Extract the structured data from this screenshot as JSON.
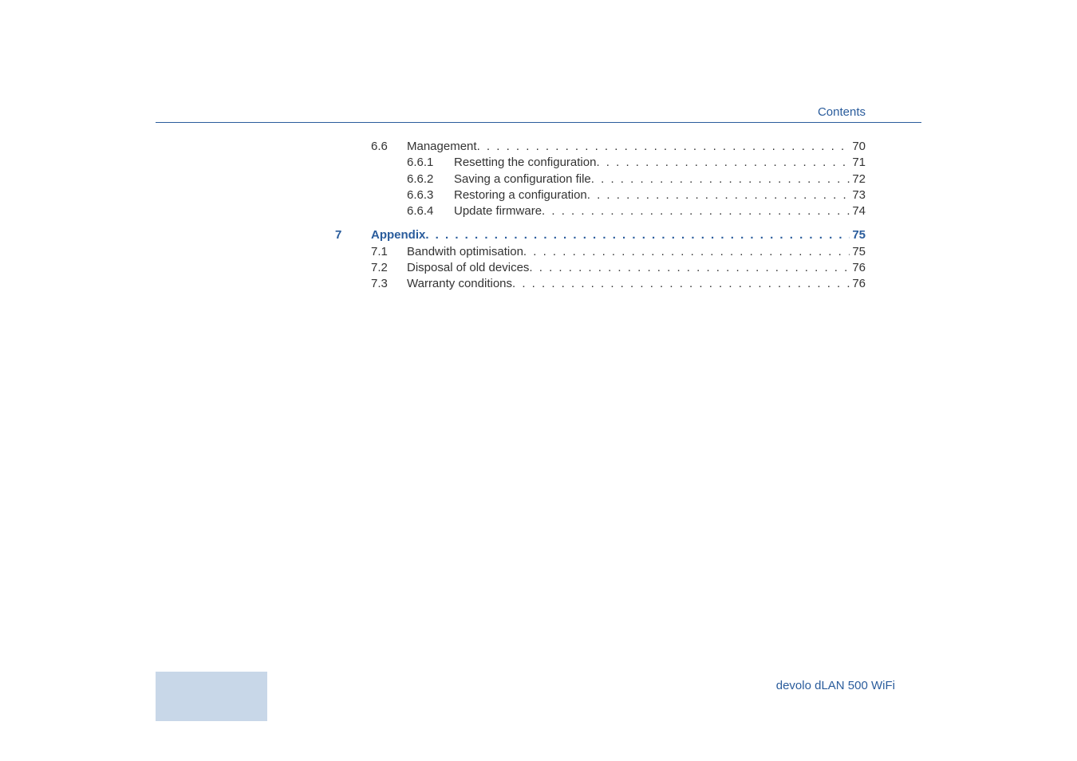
{
  "header": {
    "label": "Contents"
  },
  "toc": {
    "section66": {
      "num": "6.6",
      "label": "Management",
      "page": "70"
    },
    "section661": {
      "num": "6.6.1",
      "label": "Resetting the configuration",
      "page": "71"
    },
    "section662": {
      "num": "6.6.2",
      "label": "Saving a configuration file",
      "page": "72"
    },
    "section663": {
      "num": "6.6.3",
      "label": "Restoring a configuration",
      "page": "73"
    },
    "section664": {
      "num": "6.6.4",
      "label": "Update firmware",
      "page": "74"
    },
    "chapter7": {
      "num": "7",
      "label": "Appendix",
      "page": "75"
    },
    "section71": {
      "num": "7.1",
      "label": "Bandwith optimisation",
      "page": "75"
    },
    "section72": {
      "num": "7.2",
      "label": "Disposal of old devices",
      "page": "76"
    },
    "section73": {
      "num": "7.3",
      "label": "Warranty conditions",
      "page": "76"
    }
  },
  "footer": {
    "label": "devolo dLAN 500 WiFi"
  }
}
